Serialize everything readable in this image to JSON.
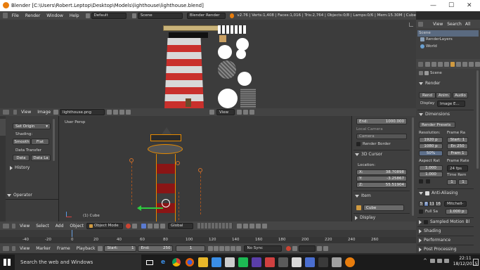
{
  "window": {
    "title": "Blender [C:\\Users\\Robert.Leptop\\Desktop\\Models\\lighthouse\\lighthouse.blend]",
    "min": "—",
    "max": "☐",
    "close": "✕"
  },
  "info_header": {
    "menus": [
      "File",
      "Render",
      "Window",
      "Help"
    ],
    "layout": "Default",
    "scene": "Scene",
    "engine": "Blender Render",
    "stats": "v2.76 | Verts:1,408 | Faces:1,016 | Tris:2,764 | Objects:0/8 | Lamps:0/6 | Mem:15.30M | Cube"
  },
  "outliner": {
    "header": [
      "View",
      "Search",
      "All"
    ],
    "items": [
      "Scene",
      "RenderLayers",
      "World"
    ]
  },
  "uv_header": {
    "menus": [
      "View",
      "Image"
    ],
    "image_name": "lighthouse.png",
    "view_label": "View"
  },
  "tool_shelf": {
    "tabs": [
      "Tools",
      "Create",
      "Relations",
      "Shading",
      "Physics",
      "Grease"
    ],
    "set_origin": "Set Origin",
    "shading_label": "Shading:",
    "smooth": "Smooth",
    "flat": "Flat",
    "data_transfer": "Data Transfer",
    "data": "Data",
    "data_layers": "Data La",
    "history": "History",
    "operator": "Operator"
  },
  "viewport": {
    "label": "User Persp",
    "object": "(1) Cube"
  },
  "n_panel": {
    "end_label": "End:",
    "end_value": "1000.000",
    "local_camera": "Local Camera",
    "camera": "Camera",
    "render_border": "Render Border",
    "cursor_title": "3D Cursor",
    "location": "Location:",
    "x_label": "X:",
    "x": "38.70898",
    "y_label": "Y:",
    "y": "-3.25867",
    "z_label": "Z:",
    "z": "55.51904",
    "item_title": "Item",
    "item_name": "Cube",
    "display_title": "Display"
  },
  "v3d_header": {
    "menus": [
      "View",
      "Select",
      "Add",
      "Object"
    ],
    "mode": "Object Mode",
    "orientation": "Global"
  },
  "timeline": {
    "ticks": [
      "-40",
      "-20",
      "0",
      "20",
      "40",
      "60",
      "80",
      "100",
      "120",
      "140",
      "160",
      "180",
      "200",
      "220",
      "240",
      "260"
    ],
    "menus": [
      "View",
      "Marker",
      "Frame",
      "Playback"
    ],
    "start_label": "Start:",
    "start": "1",
    "end_label": "End:",
    "end": "250",
    "current": "1",
    "sync": "No Sync"
  },
  "properties": {
    "context": "Scene",
    "render_title": "Render",
    "render_btn": "Rend",
    "anim_btn": "Anim",
    "audio_btn": "Audio",
    "display_label": "Display",
    "display_value": "Image E...",
    "dimensions_title": "Dimensions",
    "presets": "Render Presets",
    "resolution_label": "Resolution:",
    "res_x": "1920 p",
    "res_y": "1080 p",
    "res_pct": "50%",
    "frame_range_label": "Frame Ra",
    "start": "Start: 1",
    "end": "En 250",
    "frame": "Fram 1",
    "aspect_label": "Aspect Rat",
    "aspect_x": "1.000",
    "aspect_y": "1.000",
    "frame_rate_label": "Frame Rate",
    "fps": "24 fps",
    "time_remap": "Time Rem",
    "remap_a": "1",
    "remap_b": "1",
    "aa_title": "Anti-Aliasing",
    "aa_5": "5",
    "aa_8": "8",
    "aa_11": "11",
    "aa_16": "16",
    "aa_filter": "Mitchell-",
    "full_sample": "Full Sa",
    "filter_size": "1.000 p",
    "sampled_motion": "Sampled Motion Bl",
    "shading": "Shading",
    "performance": "Performance",
    "post_processing": "Post Processing"
  },
  "taskbar": {
    "search": "Search the web and Windows",
    "time": "22:11",
    "date": "18/12/2015"
  }
}
